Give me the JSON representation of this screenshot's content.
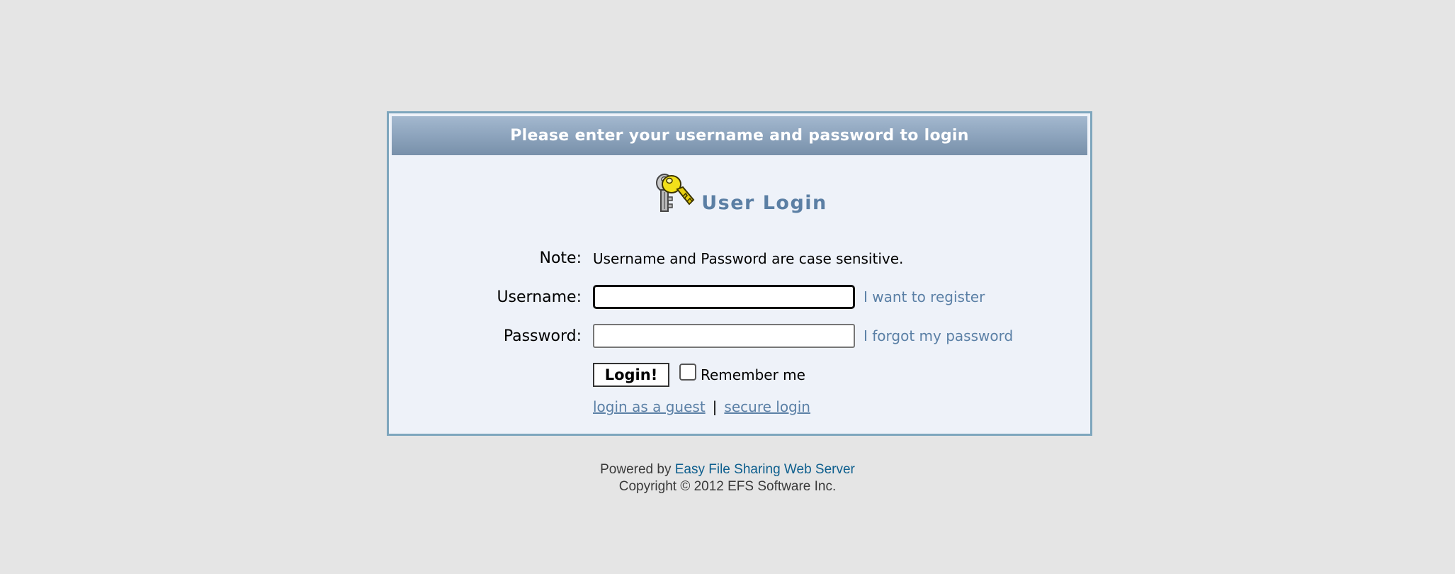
{
  "header": {
    "title": "Please enter your username and password to login"
  },
  "login": {
    "heading": "User Login",
    "icon": "keys-icon",
    "note_label": "Note:",
    "note_text": "Username and Password are case sensitive.",
    "username_label": "Username:",
    "username_value": "",
    "password_label": "Password:",
    "password_value": "",
    "register_link": "I want to register",
    "forgot_link": "I forgot my password",
    "submit_label": "Login!",
    "remember_label": "Remember me",
    "remember_checked": false,
    "guest_link": "login as a guest",
    "separator": "|",
    "secure_link": "secure login"
  },
  "footer": {
    "powered_prefix": "Powered by",
    "powered_link": "Easy File Sharing Web Server",
    "copyright": "Copyright © 2012 EFS Software Inc."
  },
  "colors": {
    "page_background": "#e5e5e5",
    "frame_border": "#7ea6bd",
    "panel_background": "#eef2f9",
    "header_gradient_top": "#a3b8cf",
    "header_gradient_bottom": "#7890aa",
    "link": "#5b80a6",
    "footer_link": "#0e5f8e"
  }
}
